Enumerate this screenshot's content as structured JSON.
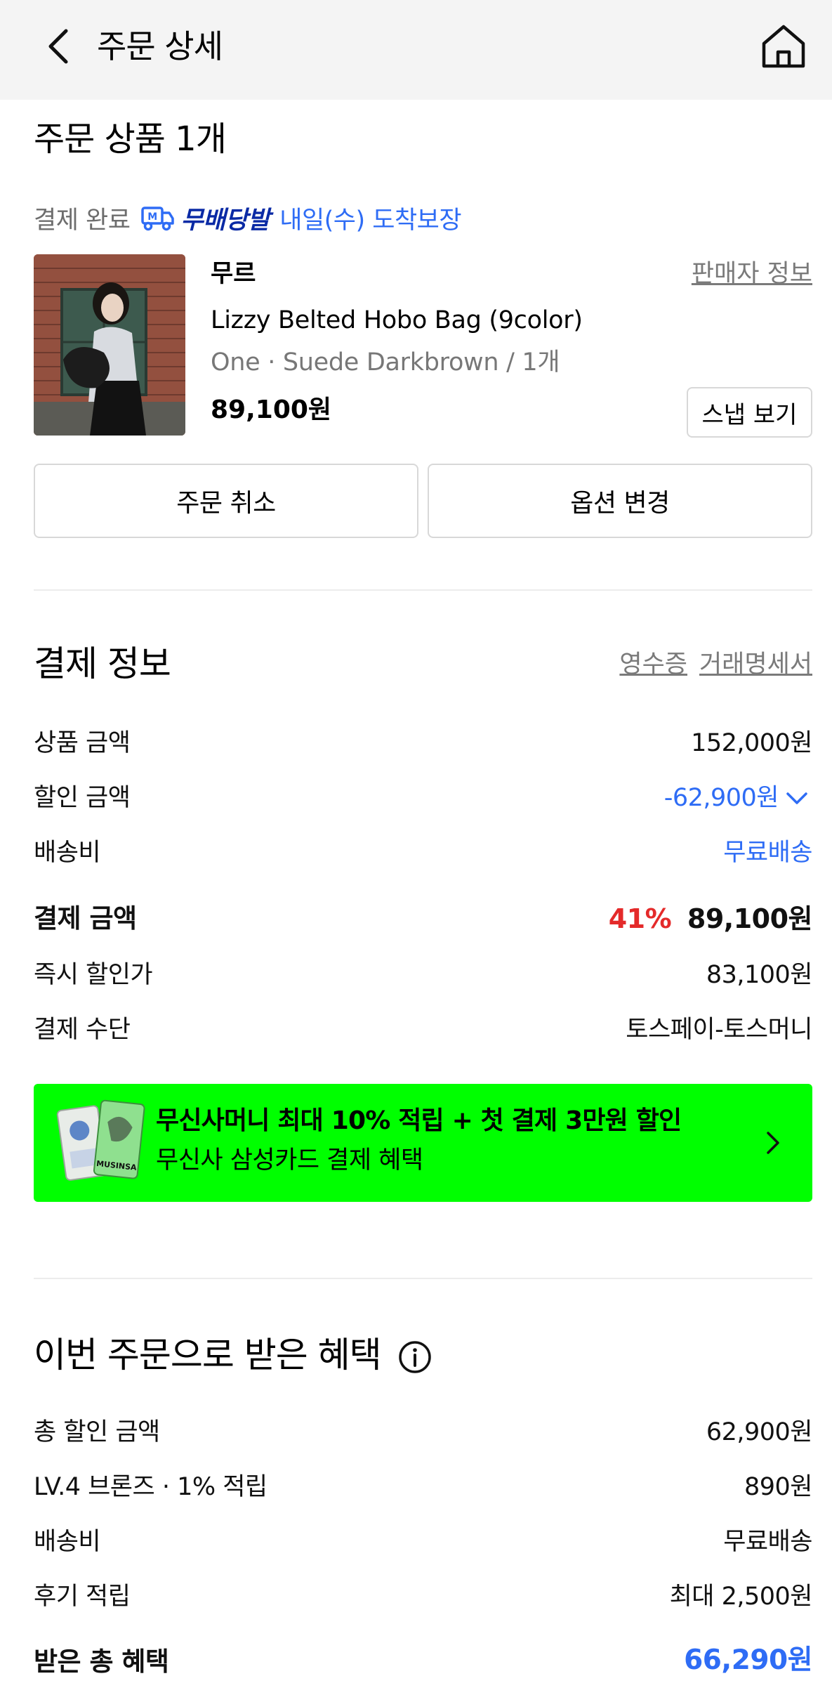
{
  "header": {
    "title": "주문 상세"
  },
  "order_items": {
    "section_title": "주문 상품 1개",
    "status": "결제 완료",
    "delivery_badge": "무배당발",
    "arrival_guarantee": "내일(수) 도착보장",
    "product": {
      "brand": "무르",
      "seller_info_link": "판매자 정보",
      "name": "Lizzy Belted Hobo Bag (9color)",
      "option": "One · Suede Darkbrown / 1개",
      "price": "89,100원",
      "snap_button": "스냅 보기"
    },
    "cancel_button": "주문 취소",
    "change_option_button": "옵션 변경"
  },
  "payment": {
    "section_title": "결제 정보",
    "receipt_link": "영수증",
    "statement_link": "거래명세서",
    "rows": {
      "product_amount": {
        "label": "상품 금액",
        "value": "152,000원"
      },
      "discount": {
        "label": "할인 금액",
        "value": "-62,900원"
      },
      "shipping": {
        "label": "배송비",
        "value": "무료배송"
      },
      "total": {
        "label": "결제 금액",
        "percent": "41%",
        "value": "89,100원"
      },
      "instant_price": {
        "label": "즉시 할인가",
        "value": "83,100원"
      },
      "method": {
        "label": "결제 수단",
        "value": "토스페이-토스머니"
      }
    },
    "promo": {
      "title": "무신사머니 최대 10% 적립 + 첫 결제 3만원 할인",
      "subtitle": "무신사 삼성카드 결제 혜택",
      "card_text": "MUSINSA"
    }
  },
  "benefits": {
    "section_title": "이번 주문으로 받은 혜택",
    "rows": {
      "total_discount": {
        "label": "총 할인 금액",
        "value": "62,900원"
      },
      "level": {
        "label": "LV.4 브론즈 · 1% 적립",
        "value": "890원"
      },
      "shipping": {
        "label": "배송비",
        "value": "무료배송"
      },
      "review": {
        "label": "후기 적립",
        "value": "최대 2,500원"
      },
      "received_total": {
        "label": "받은 총 혜택",
        "value": "66,290원"
      }
    }
  },
  "colors": {
    "accent_blue": "#2e6cf5",
    "discount_red": "#e42a2a",
    "promo_green": "#00ff00",
    "header_bg": "#f4f4f4",
    "badge_navy": "#0a2aa5"
  },
  "icons": [
    "back-arrow-icon",
    "home-icon",
    "truck-icon",
    "chevron-down-icon",
    "chevron-right-icon",
    "info-icon"
  ]
}
